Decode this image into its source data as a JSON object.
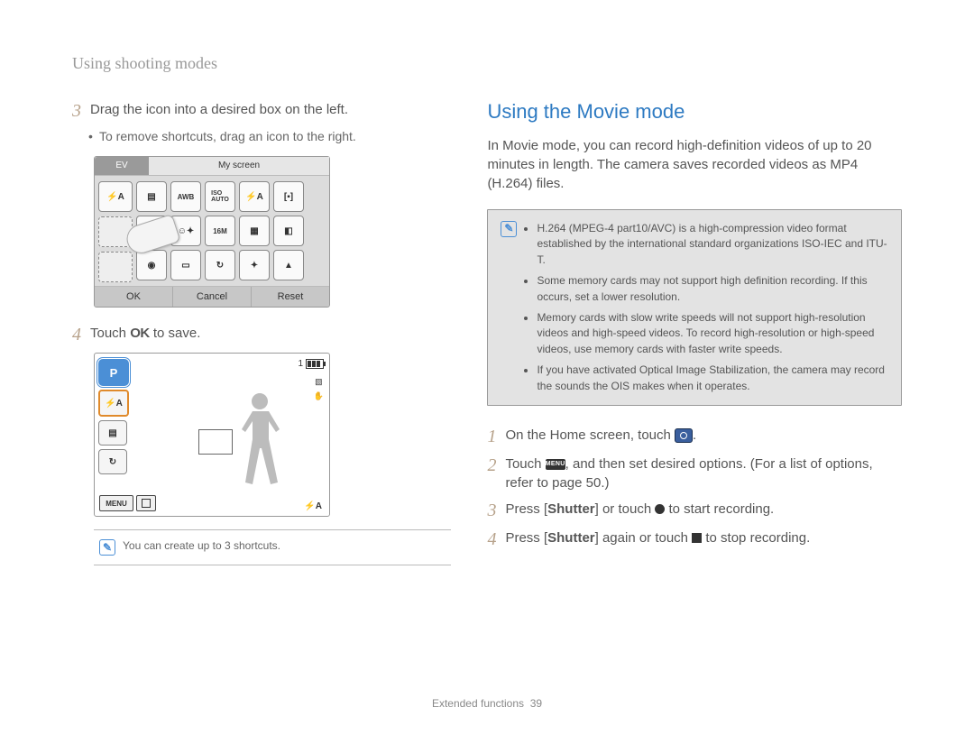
{
  "running_header": "Using shooting modes",
  "left": {
    "step3": {
      "num": "3",
      "text": "Drag the icon into a desired box on the left.",
      "bullet": "To remove shortcuts, drag an icon to the right."
    },
    "myscreen": {
      "tab_ev": "EV",
      "tab_my": "My screen",
      "btn_ok": "OK",
      "btn_cancel": "Cancel",
      "btn_reset": "Reset"
    },
    "step4": {
      "num": "4",
      "pre": "Touch ",
      "ok_label": "OK",
      "post": " to save."
    },
    "camview": {
      "p_label": "P",
      "menu_label": "MENU",
      "counter": "1",
      "flash_label": "⚡A"
    },
    "note": "You can create up to 3 shortcuts."
  },
  "right": {
    "heading": "Using the Movie mode",
    "intro": "In Movie mode, you can record high-definition videos of up to 20 minutes in length. The camera saves recorded videos as MP4 (H.264) files.",
    "info_items": [
      "H.264 (MPEG-4 part10/AVC) is a high-compression video format established by the international standard organizations ISO-IEC and ITU-T.",
      "Some memory cards may not support high definition recording. If this occurs, set a lower resolution.",
      "Memory cards with slow write speeds will not support high-resolution videos and high-speed videos. To record high-resolution or high-speed videos, use memory cards with faster write speeds.",
      "If you have activated Optical Image Stabilization, the camera may record the sounds the OIS makes when it operates."
    ],
    "step1": {
      "num": "1",
      "pre": "On the Home screen, touch ",
      "post": "."
    },
    "step2": {
      "num": "2",
      "pre": "Touch ",
      "menu_label": "MENU",
      "mid": ", and then set desired options. (For a list of options, refer to page 50.)"
    },
    "step3": {
      "num": "3",
      "pre": "Press [",
      "bold": "Shutter",
      "mid": "] or touch ",
      "post": " to start recording."
    },
    "step4": {
      "num": "4",
      "pre": "Press [",
      "bold": "Shutter",
      "mid": "] again or touch ",
      "post": " to stop recording."
    }
  },
  "footer": {
    "section": "Extended functions",
    "page": "39"
  }
}
